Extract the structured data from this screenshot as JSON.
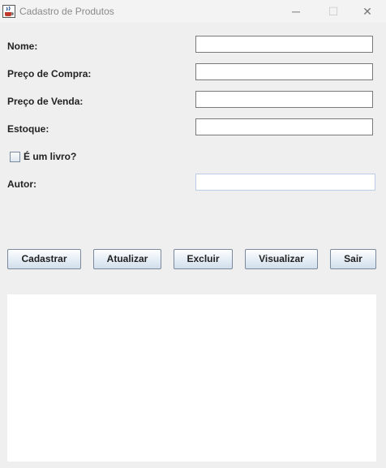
{
  "window": {
    "title": "Cadastro de Produtos",
    "minimize_glyph": "─",
    "maximize_glyph": "☐",
    "close_glyph": "✕",
    "app_icon": "java-cup-icon"
  },
  "form": {
    "nome_label": "Nome:",
    "nome_value": "",
    "preco_compra_label": "Preço de Compra:",
    "preco_compra_value": "",
    "preco_venda_label": "Preço de Venda:",
    "preco_venda_value": "",
    "estoque_label": "Estoque:",
    "estoque_value": "",
    "livro_checkbox_label": "É um livro?",
    "livro_checked": false,
    "autor_label": "Autor:",
    "autor_value": ""
  },
  "buttons": {
    "cadastrar": "Cadastrar",
    "atualizar": "Atualizar",
    "excluir": "Excluir",
    "visualizar": "Visualizar",
    "sair": "Sair"
  },
  "output": {
    "text": ""
  }
}
